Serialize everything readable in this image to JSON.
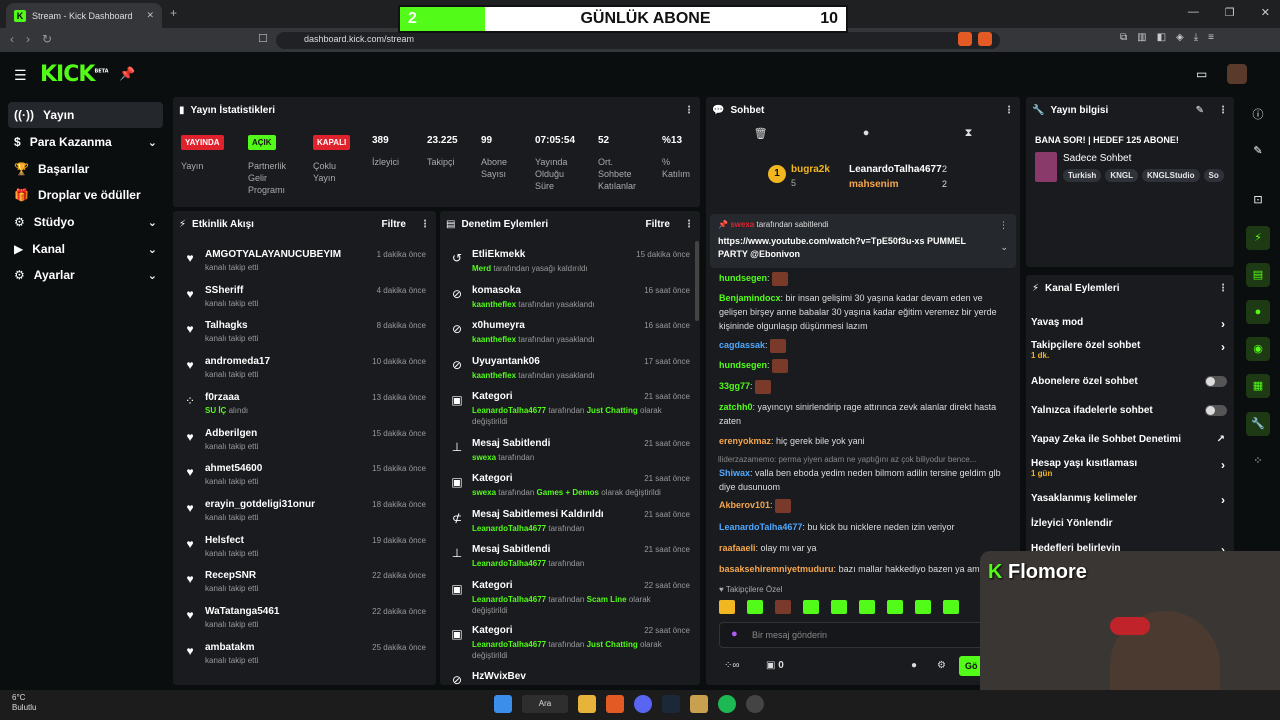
{
  "browser": {
    "tab_title": "Stream - Kick Dashboard",
    "url": "dashboard.kick.com/stream"
  },
  "overlay": {
    "current": "2",
    "title": "GÜNLÜK ABONE",
    "goal": "10"
  },
  "logo": {
    "text": "KICK",
    "sup": "BETA"
  },
  "sidebar": {
    "items": [
      {
        "label": "Yayın",
        "icon": "broadcast-icon"
      },
      {
        "label": "Para Kazanma",
        "icon": "money-icon"
      },
      {
        "label": "Başarılar",
        "icon": "trophy-icon"
      },
      {
        "label": "Droplar ve ödüller",
        "icon": "gift-icon"
      },
      {
        "label": "Stüdyo",
        "icon": "studio-icon"
      },
      {
        "label": "Kanal",
        "icon": "channel-icon"
      },
      {
        "label": "Ayarlar",
        "icon": "gear-icon"
      }
    ]
  },
  "stats": {
    "title": "Yayın İstatistikleri",
    "badges": [
      {
        "text": "YAYINDA",
        "label": "Yayın",
        "color": "#e0222d"
      },
      {
        "text": "AÇIK",
        "label": "Partnerlik Gelir Programı",
        "color": "#53fc18"
      },
      {
        "text": "KAPALI",
        "label": "Çoklu Yayın",
        "color": "#e0222d"
      }
    ],
    "metrics": [
      {
        "value": "389",
        "label": "İzleyici"
      },
      {
        "value": "23.225",
        "label": "Takipçi"
      },
      {
        "value": "99",
        "label": "Abone Sayısı"
      },
      {
        "value": "07:05:54",
        "label": "Yayında Olduğu Süre"
      },
      {
        "value": "52",
        "label": "Ort. Sohbete Katılanlar"
      },
      {
        "value": "%13",
        "label": "% Katılım"
      }
    ]
  },
  "activity": {
    "title": "Etkinlik Akışı",
    "filter": "Filtre",
    "items": [
      {
        "name": "AMGOTYALAYANUCUBEYIM",
        "sub": "kanalı takip etti",
        "time": "1 dakika önce",
        "icon": "heart-icon"
      },
      {
        "name": "SSheriff",
        "sub": "kanalı takip etti",
        "time": "4 dakika önce",
        "icon": "heart-icon"
      },
      {
        "name": "Talhagks",
        "sub": "kanalı takip etti",
        "time": "8 dakika önce",
        "icon": "heart-icon"
      },
      {
        "name": "andromeda17",
        "sub": "kanalı takip etti",
        "time": "10 dakika önce",
        "icon": "heart-icon"
      },
      {
        "name": "f0rzaaa",
        "sub": "SU İÇ",
        "sub2": "alındı",
        "time": "13 dakika önce",
        "icon": "reward-icon"
      },
      {
        "name": "Adberilgen",
        "sub": "kanalı takip etti",
        "time": "15 dakika önce",
        "icon": "heart-icon"
      },
      {
        "name": "ahmet54600",
        "sub": "kanalı takip etti",
        "time": "15 dakika önce",
        "icon": "heart-icon"
      },
      {
        "name": "erayin_gotdeligi31onur",
        "sub": "kanalı takip etti",
        "time": "18 dakika önce",
        "icon": "heart-icon"
      },
      {
        "name": "Helsfect",
        "sub": "kanalı takip etti",
        "time": "19 dakika önce",
        "icon": "heart-icon"
      },
      {
        "name": "RecepSNR",
        "sub": "kanalı takip etti",
        "time": "22 dakika önce",
        "icon": "heart-icon"
      },
      {
        "name": "WaTatanga5461",
        "sub": "kanalı takip etti",
        "time": "22 dakika önce",
        "icon": "heart-icon"
      },
      {
        "name": "ambatakm",
        "sub": "kanalı takip etti",
        "time": "25 dakika önce",
        "icon": "heart-icon"
      }
    ]
  },
  "moderation": {
    "title": "Denetim Eylemleri",
    "filter": "Filtre",
    "items": [
      {
        "name": "EtliEkmekk",
        "actor": "Merd",
        "rest": "tarafından yasağı kaldırıldı",
        "time": "15 dakika önce",
        "icon": "undo-icon"
      },
      {
        "name": "komasoka",
        "actor": "kaantheflex",
        "rest": "tarafından yasaklandı",
        "time": "16 saat önce",
        "icon": "ban-icon"
      },
      {
        "name": "x0humeyra",
        "actor": "kaantheflex",
        "rest": "tarafından yasaklandı",
        "time": "16 saat önce",
        "icon": "ban-icon"
      },
      {
        "name": "Uyuyantank06",
        "actor": "kaantheflex",
        "rest": "tarafından yasaklandı",
        "time": "17 saat önce",
        "icon": "ban-icon"
      },
      {
        "name": "Kategori",
        "actor": "LeanardoTalha4677",
        "rest": "tarafından",
        "cat": "Just Chatting",
        "rest2": "olarak değiştirildi",
        "time": "21 saat önce",
        "icon": "category-icon"
      },
      {
        "name": "Mesaj Sabitlendi",
        "actor": "swexa",
        "rest": "tarafından",
        "time": "21 saat önce",
        "icon": "pin-icon"
      },
      {
        "name": "Kategori",
        "actor": "swexa",
        "rest": "tarafından",
        "cat": "Games + Demos",
        "rest2": "olarak değiştirildi",
        "time": "21 saat önce",
        "icon": "category-icon"
      },
      {
        "name": "Mesaj Sabitlemesi Kaldırıldı",
        "actor": "LeanardoTalha4677",
        "rest": "tarafından",
        "time": "21 saat önce",
        "icon": "unpin-icon"
      },
      {
        "name": "Mesaj Sabitlendi",
        "actor": "LeanardoTalha4677",
        "rest": "tarafından",
        "time": "21 saat önce",
        "icon": "pin-icon"
      },
      {
        "name": "Kategori",
        "actor": "LeanardoTalha4677",
        "rest": "tarafından",
        "cat": "Scam Line",
        "rest2": "olarak değiştirildi",
        "time": "22 saat önce",
        "icon": "category-icon"
      },
      {
        "name": "Kategori",
        "actor": "LeanardoTalha4677",
        "rest": "tarafından",
        "cat": "Just Chatting",
        "rest2": "olarak değiştirildi",
        "time": "22 saat önce",
        "icon": "category-icon"
      },
      {
        "name": "HzWvixBev",
        "actor": "",
        "rest": "",
        "time": "",
        "icon": "ban-icon"
      }
    ]
  },
  "chat": {
    "title": "Sohbet",
    "leaders": [
      {
        "name": "bugra2k",
        "count": "5"
      },
      {
        "name": "LeanardoTalha4677",
        "count": "2"
      },
      {
        "name": "mahsenim",
        "count": "2"
      }
    ],
    "pinned": {
      "by": "swexa",
      "by_rest": "tarafından sabitlendi",
      "text": "https://www.youtube.com/watch?v=TpE50f3u-xs PUMMEL PARTY @Ebonivon"
    },
    "messages": [
      {
        "user": "hundsegen",
        "color": "#53fc18",
        "text": "",
        "emote": true
      },
      {
        "user": "Benjamindocx",
        "color": "#53fc18",
        "text": "bir insan gelişimi 30 yaşına kadar devam eden ve gelişen birşey anne babalar 30 yaşına kadar eğitim veremez bir yerde kişininde olgunlaşıp düşünmesi lazım"
      },
      {
        "user": "cagdassak",
        "color": "#4fa8ff",
        "text": "",
        "emote": true
      },
      {
        "user": "hundsegen",
        "color": "#53fc18",
        "text": "",
        "emote": true
      },
      {
        "user": "33gg77",
        "color": "#53fc18",
        "text": "",
        "emote": true
      },
      {
        "user": "zatchh0",
        "color": "#53fc18",
        "text": "yayıncıyı sinirlendirip rage attırınca zevk alanlar direkt hasta zaten"
      },
      {
        "user": "erenyokmaz",
        "color": "#f6a64b",
        "text": "hiç gerek bile yok yani"
      },
      {
        "user": "Shiwax",
        "color": "#4fa8ff",
        "text": "valla ben eboda yedim neden bilmom adilin tersine geldim glb diye dusunuom"
      },
      {
        "user": "Akberov101",
        "color": "#f6a64b",
        "text": "",
        "emote": true
      },
      {
        "user": "LeanardoTalha4677",
        "color": "#4fa8ff",
        "text": "bu kick bu nicklere neden izin veriyor"
      },
      {
        "user": "raafaaeli",
        "color": "#f6a64b",
        "text": "olay mı var ya"
      },
      {
        "user": "basaksehiremniyetmuduru",
        "color": "#f6a64b",
        "text": "bazı mallar hakkediyo bazen ya am"
      }
    ],
    "reply_preview": "lliderzazamemo: perma yiyen adam ne yaptığını az çok biliyodur bence...",
    "followers_only": "Takipçilere Özel",
    "placeholder": "Bir mesaj gönderin",
    "points": "0",
    "send_label": "Gö"
  },
  "streaminfo": {
    "title": "Yayın bilgisi",
    "stream_title": "BANA SOR! | HEDEF 125 ABONE!",
    "category": "Sadece Sohbet",
    "tags": [
      "Turkish",
      "KNGL",
      "KNGLStudio",
      "So"
    ]
  },
  "channel_actions": {
    "title": "Kanal Eylemleri",
    "items": [
      {
        "label": "Yavaş mod",
        "type": "chevron"
      },
      {
        "label": "Takipçilere özel sohbet",
        "sub": "1 dk.",
        "type": "chevron"
      },
      {
        "label": "Abonelere özel sohbet",
        "type": "toggle"
      },
      {
        "label": "Yalnızca ifadelerle sohbet",
        "type": "toggle"
      },
      {
        "label": "Yapay Zeka ile Sohbet Denetimi",
        "type": "external"
      },
      {
        "label": "Hesap yaşı kısıtlaması",
        "sub": "1 gün",
        "type": "chevron"
      },
      {
        "label": "Yasaklanmış kelimeler",
        "type": "chevron"
      },
      {
        "label": "İzleyici Yönlendir",
        "type": "none"
      },
      {
        "label": "Hedefleri belirleyin",
        "type": "chevron"
      }
    ]
  },
  "webcam": {
    "brand_k": "K",
    "brand": "Flomore"
  },
  "taskbar": {
    "temp": "6°C",
    "weather": "Bulutlu",
    "search": "Ara"
  }
}
